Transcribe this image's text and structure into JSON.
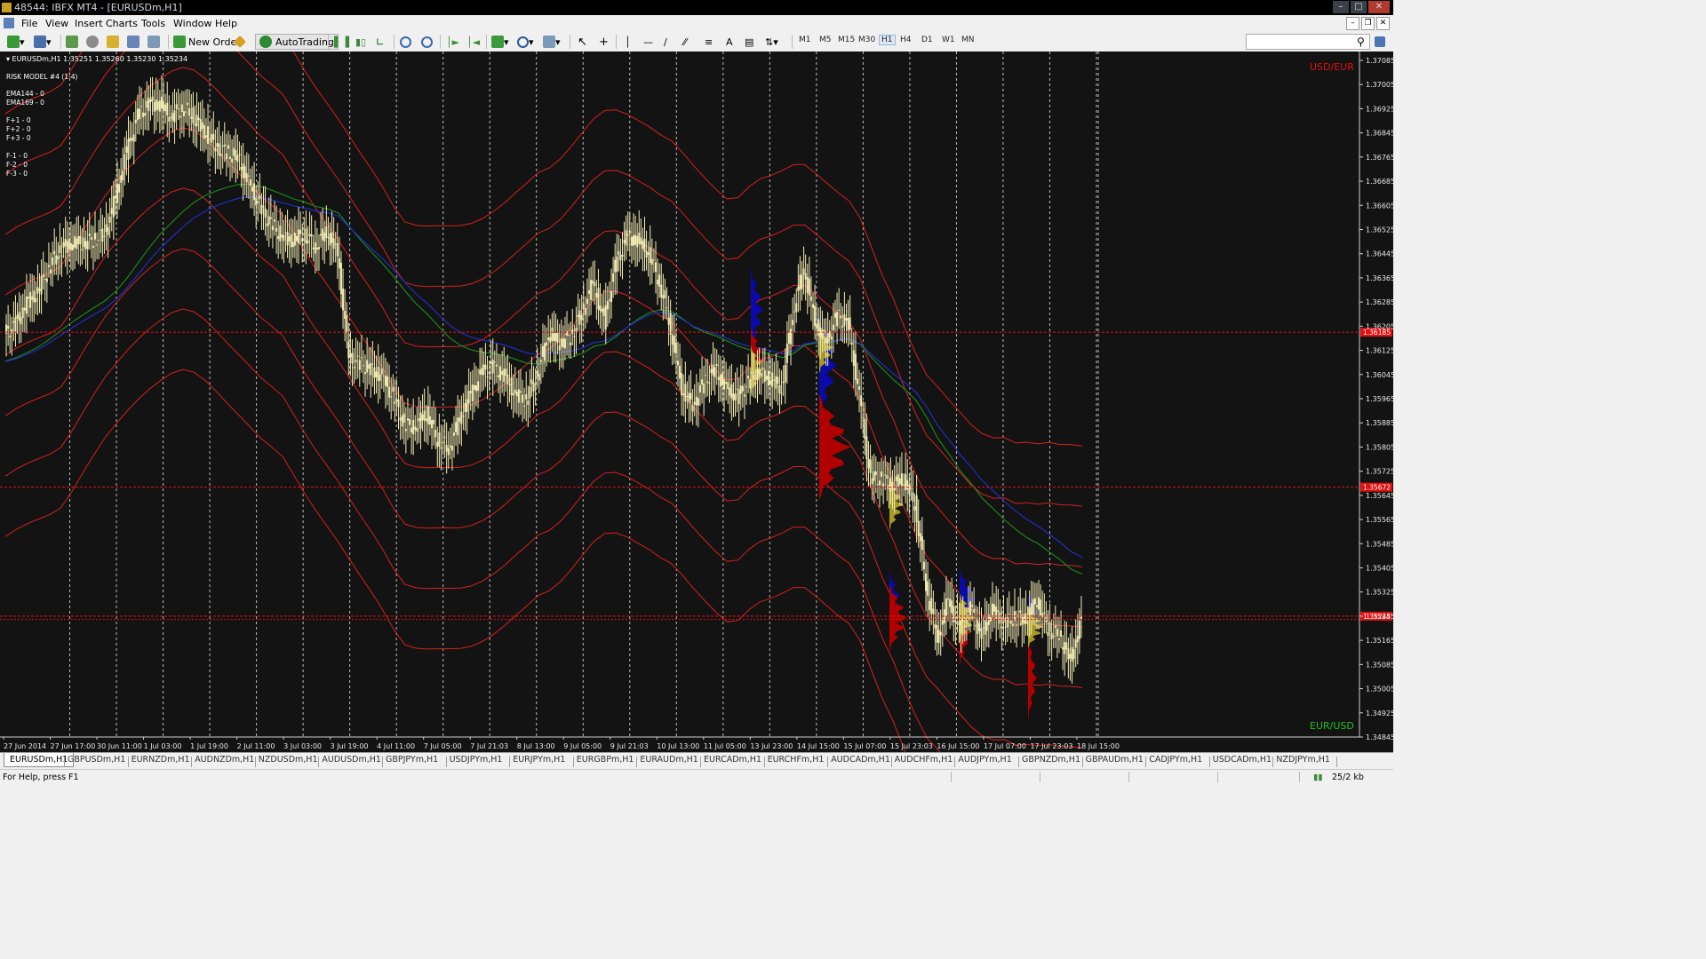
{
  "window": {
    "title": "48544: IBFX MT4 - [EURUSDm,H1]"
  },
  "menu": [
    "File",
    "View",
    "Insert",
    "Charts",
    "Tools",
    "Window",
    "Help"
  ],
  "toolbar": {
    "new_order": "New Order",
    "autotrading": "AutoTrading",
    "timeframes": [
      "M1",
      "M5",
      "M15",
      "M30",
      "H1",
      "H4",
      "D1",
      "W1",
      "MN"
    ],
    "selected_timeframe": "H1"
  },
  "chart": {
    "symbol_line": "EURUSDm,H1  1.35251 1.35260 1.35230 1.35234",
    "indicator_info": [
      "RISK MODEL #4 (1-4)",
      "EMA144 - 0",
      "EMA169 - 0",
      "F+1 - 0",
      "F+2 - 0",
      "F+3 - 0",
      "F-1 - 0",
      "F-2 - 0",
      "F-3 - 0"
    ],
    "label_top": "USD/EUR",
    "label_bottom": "EUR/USD",
    "colors": {
      "background": "#131313",
      "candle": "#f2ecb4",
      "band": "#d42020",
      "ema144": "#1c8c1c",
      "ema169": "#2030d0",
      "profile_blue": "#0a0aa8",
      "profile_red": "#b00000",
      "profile_yellow": "#a89a20",
      "price_label": "#e01010"
    }
  },
  "chart_data": {
    "type": "candlestick",
    "symbol": "EURUSDm",
    "timeframe": "H1",
    "ohlc_current": {
      "open": 1.35251,
      "high": 1.3526,
      "low": 1.3523,
      "close": 1.35234
    },
    "y_ticks": [
      "1.37085",
      "1.37005",
      "1.36925",
      "1.36845",
      "1.36765",
      "1.36685",
      "1.36605",
      "1.36525",
      "1.36445",
      "1.36365",
      "1.36285",
      "1.36205",
      "1.36125",
      "1.36045",
      "1.35965",
      "1.35885",
      "1.35805",
      "1.35725",
      "1.35645",
      "1.35565",
      "1.35485",
      "1.35405",
      "1.35325",
      "1.35245",
      "1.35165",
      "1.35085",
      "1.35005",
      "1.34925",
      "1.34845"
    ],
    "ylim": [
      1.34845,
      1.37085
    ],
    "x_ticks": [
      "27 Jun 2014",
      "27 Jun 17:00",
      "30 Jun 11:00",
      "1 Jul 03:00",
      "1 Jul 19:00",
      "2 Jul 11:00",
      "3 Jul 03:00",
      "3 Jul 19:00",
      "4 Jul 11:00",
      "7 Jul 05:00",
      "7 Jul 21:03",
      "8 Jul 13:00",
      "9 Jul 05:00",
      "9 Jul 21:03",
      "10 Jul 13:00",
      "11 Jul 05:00",
      "13 Jul 23:00",
      "14 Jul 15:00",
      "15 Jul 07:00",
      "15 Jul 23:03",
      "16 Jul 15:00",
      "17 Jul 07:00",
      "17 Jul 23:03",
      "18 Jul 15:00"
    ],
    "close_path": [
      1.3618,
      1.3621,
      1.3628,
      1.3632,
      1.364,
      1.3646,
      1.3648,
      1.3648,
      1.3649,
      1.3651,
      1.3663,
      1.3678,
      1.369,
      1.3694,
      1.3694,
      1.369,
      1.3693,
      1.369,
      1.3685,
      1.368,
      1.3678,
      1.3676,
      1.3668,
      1.366,
      1.3654,
      1.365,
      1.3649,
      1.3651,
      1.3647,
      1.3652,
      1.3645,
      1.361,
      1.3608,
      1.3606,
      1.3604,
      1.3597,
      1.3588,
      1.3587,
      1.3592,
      1.3583,
      1.358,
      1.359,
      1.3598,
      1.3605,
      1.3607,
      1.3604,
      1.3598,
      1.3596,
      1.3605,
      1.3618,
      1.3615,
      1.3617,
      1.3625,
      1.3635,
      1.3622,
      1.364,
      1.365,
      1.3649,
      1.3645,
      1.3635,
      1.362,
      1.36,
      1.3594,
      1.3602,
      1.3606,
      1.36,
      1.3597,
      1.3602,
      1.3605,
      1.3603,
      1.36,
      1.3625,
      1.364,
      1.3622,
      1.3615,
      1.3624,
      1.3621,
      1.3597,
      1.357,
      1.357,
      1.3568,
      1.357,
      1.3562,
      1.3535,
      1.3517,
      1.353,
      1.352,
      1.3527,
      1.3518,
      1.3527,
      1.3522,
      1.3524,
      1.3524,
      1.353,
      1.352,
      1.3518,
      1.351,
      1.3523
    ],
    "current_price": 1.35234,
    "price_lines": [
      1.36185,
      1.35672,
      1.35245
    ],
    "price_labels": [
      "1.36185",
      "1.35672",
      "1.35245"
    ],
    "series": [
      {
        "name": "EMA144"
      },
      {
        "name": "EMA169"
      }
    ]
  },
  "tabs": [
    "EURUSDm,H1",
    "GBPUSDm,H1",
    "EURNZDm,H1",
    "AUDNZDm,H1",
    "NZDUSDm,H1",
    "AUDUSDm,H1",
    "GBPJPYm,H1",
    "USDJPYm,H1",
    "EURJPYm,H1",
    "EURGBPm,H1",
    "EURAUDm,H1",
    "EURCADm,H1",
    "EURCHFm,H1",
    "AUDCADm,H1",
    "AUDCHFm,H1",
    "AUDJPYm,H1",
    "GBPNZDm,H1",
    "GBPAUDm,H1",
    "CADJPYm,H1",
    "USDCADm,H1",
    "NZDJPYm,H1"
  ],
  "status": {
    "help": "For Help, press F1",
    "traffic": "25/2 kb"
  }
}
